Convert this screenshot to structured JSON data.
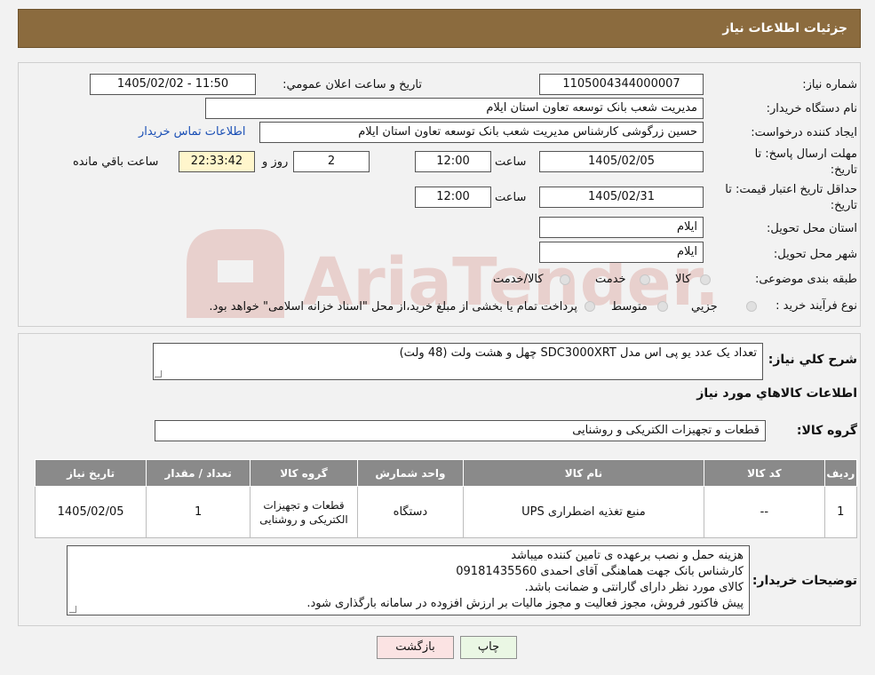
{
  "header": {
    "title": "جزئیات اطلاعات نیاز"
  },
  "watermark": {
    "text": "AriaTender.neT",
    "color": "#c0392b"
  },
  "form": {
    "need_number_label": "شماره نیاز:",
    "need_number": "1105004344000007",
    "announce_label": "تاریخ و ساعت اعلان عمومي:",
    "announce_value": "1405/02/02 - 11:50",
    "buyer_org_label": "نام دستگاه خریدار:",
    "buyer_org": "مدیریت شعب بانک توسعه تعاون استان ایلام",
    "creator_label": "ایجاد کننده درخواست:",
    "creator": "حسین زرگوشی کارشناس مدیریت شعب بانک توسعه تعاون استان ایلام",
    "contact_link": "اطلاعات تماس خریدار",
    "deadline_label_1": "مهلت ارسال پاسخ: تا",
    "deadline_label_2": "تاریخ:",
    "deadline_date": "1405/02/05",
    "time_label": "ساعت",
    "deadline_time": "12:00",
    "days_value": "2",
    "days_label": "روز و",
    "remaining_time": "22:33:42",
    "remaining_label": "ساعت باقي مانده",
    "price_validity_label_1": "حداقل تاریخ اعتبار قیمت: تا",
    "price_validity_label_2": "تاریخ:",
    "price_validity_date": "1405/02/31",
    "price_validity_time": "12:00",
    "province_label": "استان محل تحویل:",
    "province": "ایلام",
    "city_label": "شهر محل تحویل:",
    "city": "ایلام",
    "category_label": "طبقه بندی موضوعی:",
    "category_options": [
      "کالا",
      "خدمت",
      "کالا/خدمت"
    ],
    "process_label": "نوع فرآیند خرید :",
    "process_options": [
      "جزیي",
      "متوسط"
    ],
    "process_note": "پرداخت تمام یا بخشی از مبلغ خرید،از محل \"اسناد خزانه اسلامی\" خواهد بود."
  },
  "details": {
    "desc_label": "شرح کلي نیاز:",
    "desc_value": "تعداد یک عدد یو پی اس مدل SDC3000XRT چهل و هشت ولت (48 ولت)",
    "goods_info_title": "اطلاعات کالاهاي مورد نیاز",
    "group_label": "گروه کالا:",
    "group_value": "قطعات و تجهیزات الکتریکی و روشنایی"
  },
  "table": {
    "headers": [
      "ردیف",
      "کد کالا",
      "نام کالا",
      "واحد شمارش",
      "گروه کالا",
      "تعداد / مقدار",
      "تاریخ نیاز"
    ],
    "rows": [
      [
        "1",
        "--",
        "منبع تغذیه اضطراری UPS",
        "دستگاه",
        "قطعات و تجهیزات الکتریکی و روشنایی",
        "1",
        "1405/02/05"
      ]
    ]
  },
  "buyer_notes": {
    "label": "توضیحات خریدار:",
    "lines": [
      "هزینه حمل و نصب برعهده ی تامین کننده میباشد",
      "کارشناس بانک جهت هماهنگی آقای احمدی 09181435560",
      "کالای مورد نظر دارای گارانتی و ضمانت باشد.",
      "پیش فاکتور فروش، مجوز فعالیت و مجوز مالیات بر ارزش افزوده در سامانه بارگذاری شود."
    ]
  },
  "buttons": {
    "print": "چاپ",
    "back": "بازگشت"
  },
  "colors": {
    "header_bg": "#8b6b3e",
    "back_btn_bg": "#fbe3e3",
    "print_btn_bg": "#eaf7e4"
  }
}
